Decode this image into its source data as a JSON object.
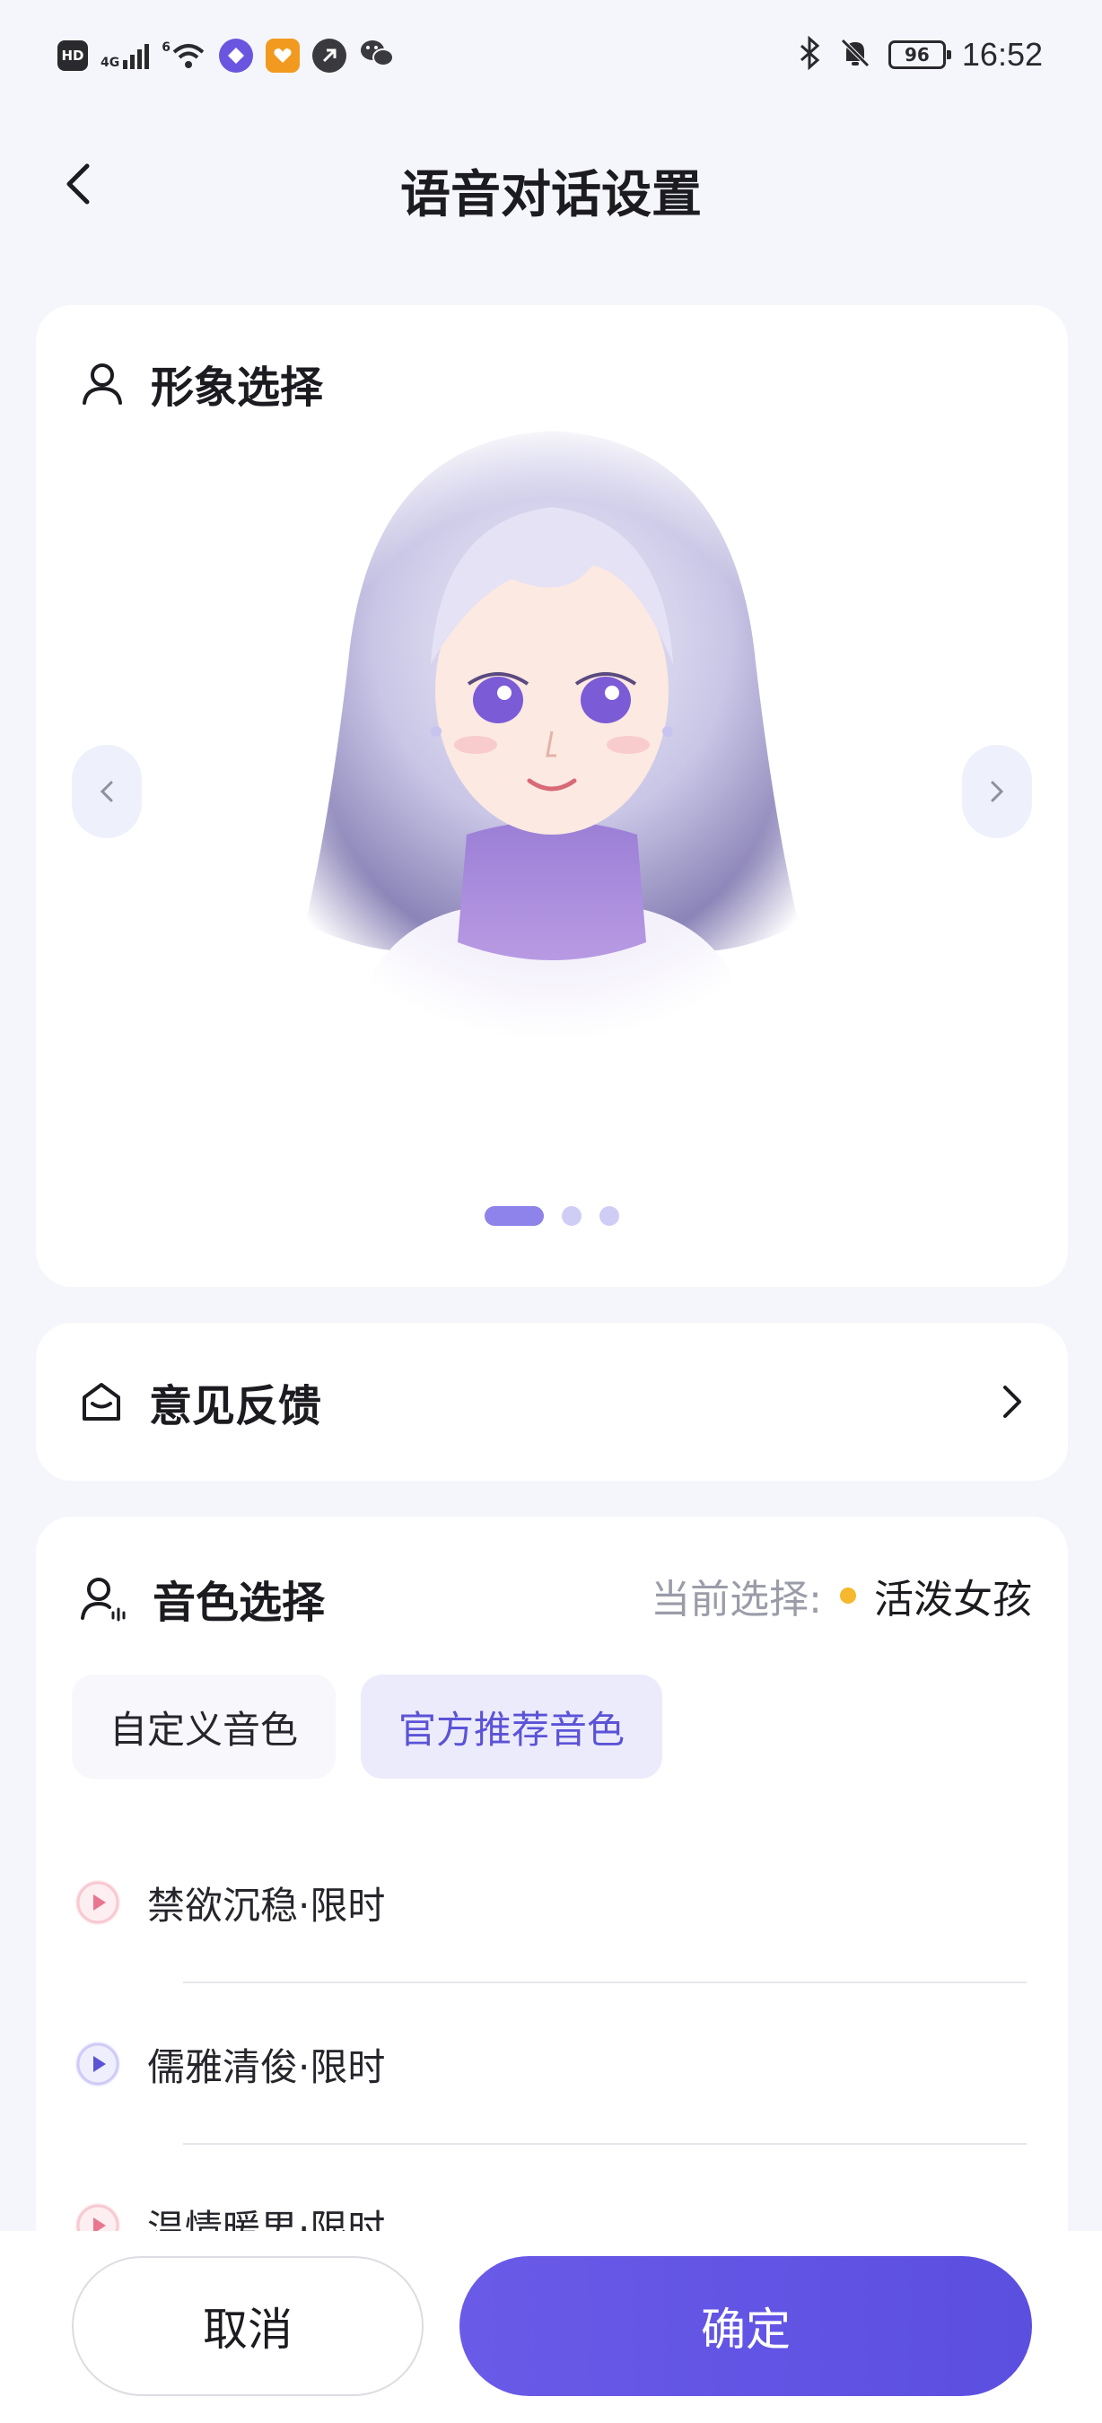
{
  "status_bar": {
    "hd": "HD",
    "net1": "4G",
    "net2": "6",
    "battery": "96",
    "time": "16:52",
    "icons": [
      "hd-icon",
      "signal-icon",
      "wifi-icon",
      "app-purple-icon",
      "app-orange-icon",
      "app-gray-icon",
      "wechat-icon",
      "bluetooth-icon",
      "mute-bell-icon",
      "battery-icon"
    ]
  },
  "header": {
    "title": "语音对话设置"
  },
  "avatar_section": {
    "title": "形象选择",
    "icon": "person-icon",
    "page_count": 3,
    "active_page": 1
  },
  "feedback": {
    "title": "意见反馈",
    "icon": "mail-box-icon"
  },
  "voice_section": {
    "title": "音色选择",
    "icon": "voice-person-icon",
    "current_label": "当前选择:",
    "current_value": "活泼女孩",
    "tabs": [
      {
        "label": "自定义音色",
        "active": false
      },
      {
        "label": "官方推荐音色",
        "active": true
      }
    ],
    "items": [
      {
        "name": "禁欲沉稳·限时",
        "accent": "#e8768e"
      },
      {
        "name": "儒雅清俊·限时",
        "accent": "#5b53d6"
      },
      {
        "name": "温情暖男·限时",
        "accent": "#e8768e"
      }
    ]
  },
  "footer": {
    "cancel": "取消",
    "confirm": "确定"
  },
  "colors": {
    "accent": "#5b4fe0",
    "background": "#f5f6fb",
    "current_dot": "#f5b82e"
  }
}
